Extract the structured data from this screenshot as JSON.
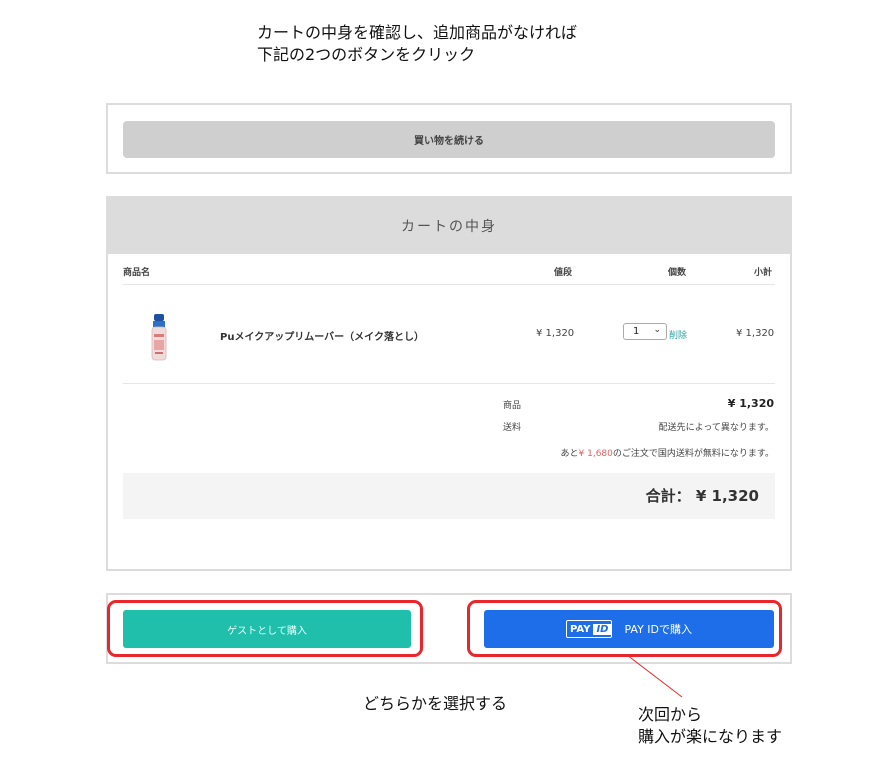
{
  "instructions": {
    "line1": "カートの中身を確認し、追加商品がなければ",
    "line2": "下記の2つのボタンをクリック"
  },
  "continue_button": {
    "label": "買い物を続ける"
  },
  "cart": {
    "title": "カートの中身",
    "columns": {
      "name": "商品名",
      "price": "値段",
      "qty": "個数",
      "subtotal": "小計"
    },
    "items": [
      {
        "name": "Puメイクアップリムーバー（メイク落とし）",
        "price": "¥ 1,320",
        "quantity": "1",
        "delete_label": "削除",
        "subtotal": "¥ 1,320"
      }
    ],
    "summary": {
      "products_label": "商品",
      "products_value": "¥ 1,320",
      "shipping_label": "送料",
      "shipping_value": "配送先によって異なります。",
      "free_shipping_prefix": "あと",
      "free_shipping_amount": "¥ 1,680",
      "free_shipping_suffix": "のご注文で国内送料が無料になります。",
      "total_label": "合計：",
      "total_value": "¥ 1,320"
    }
  },
  "payment": {
    "guest_label": "ゲストとして購入",
    "payid_logo_pay": "PAY",
    "payid_logo_id": "ID",
    "payid_label": "PAY IDで購入"
  },
  "annotations": {
    "choose": "どちらかを選択する",
    "next_line1": "次回から",
    "next_line2": "購入が楽になります"
  },
  "colors": {
    "guest_button": "#1fbfab",
    "payid_button": "#1d6ee8",
    "highlight": "#e8262c",
    "delete_link": "#2aa4a0",
    "free_amount": "#e26262"
  }
}
